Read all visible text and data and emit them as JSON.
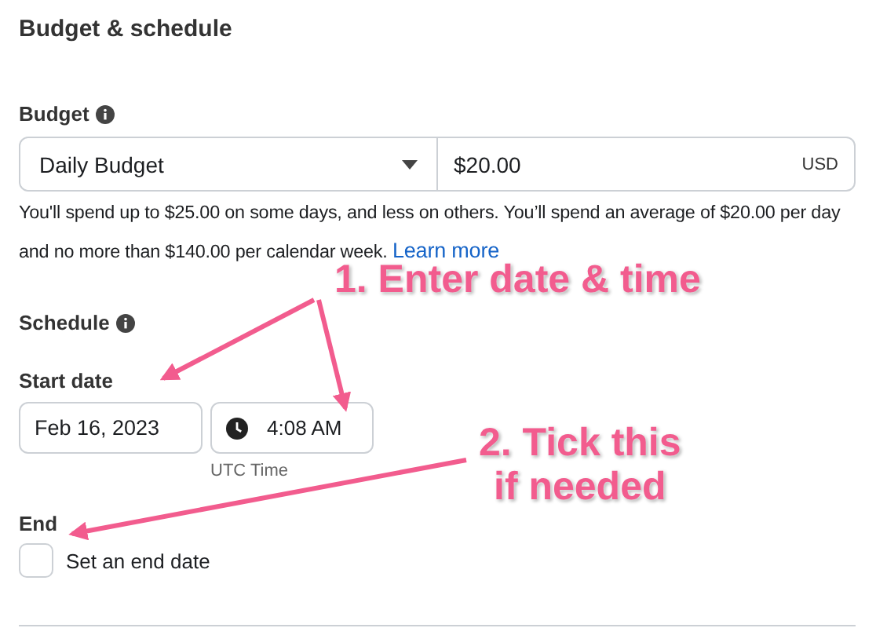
{
  "section": {
    "title": "Budget & schedule"
  },
  "budget": {
    "label": "Budget",
    "type_select": {
      "value": "Daily Budget"
    },
    "amount": {
      "value": "$20.00",
      "currency": "USD"
    },
    "help_text": "You'll spend up to $25.00 on some days, and less on others. You’ll spend an average of $20.00 per day and no more than $140.00 per calendar week.",
    "help_link": "Learn more"
  },
  "schedule": {
    "label": "Schedule",
    "start_label": "Start date",
    "date": {
      "value": "Feb 16, 2023"
    },
    "time": {
      "value": "4:08 AM"
    },
    "time_zone": "UTC Time",
    "end_label": "End",
    "end_checkbox": {
      "label": "Set an end date",
      "checked": false
    }
  },
  "annotations": [
    {
      "lines": [
        "1. Enter date & time"
      ]
    },
    {
      "lines": [
        "2. Tick this",
        "if needed"
      ]
    }
  ]
}
